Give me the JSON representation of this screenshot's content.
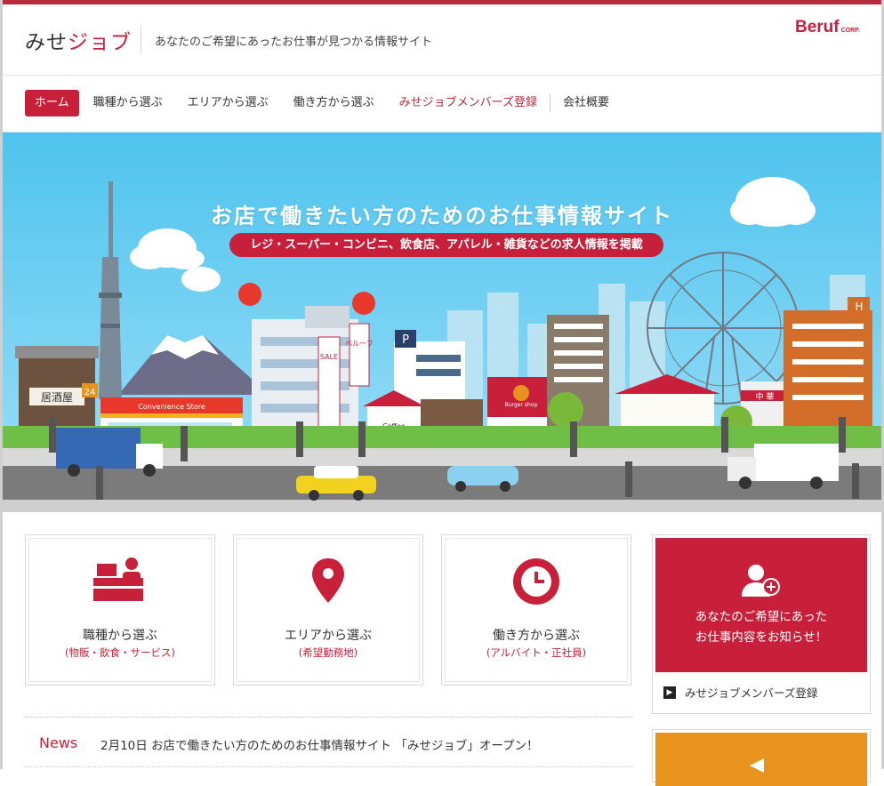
{
  "header": {
    "logo_part1": "みせ",
    "logo_part2": "ジョブ",
    "tagline": "あなたのご希望にあったお仕事が見つかる情報サイト",
    "brand": "Beruf",
    "brand_suffix": "CORP."
  },
  "nav": {
    "items": [
      {
        "label": "ホーム"
      },
      {
        "label": "職種から選ぶ"
      },
      {
        "label": "エリアから選ぶ"
      },
      {
        "label": "働き方から選ぶ"
      },
      {
        "label": "みせジョブメンバーズ登録"
      },
      {
        "label": "会社概要"
      }
    ]
  },
  "hero": {
    "title": "お店で働きたい方のためのお仕事情報サイト",
    "subtitle": "レジ・スーパー・コンビニ、飲食店、アパレル・雑貨などの求人情報を掲載",
    "signs": {
      "izakaya": "居酒屋",
      "store_24": "24",
      "convenience": "Convenience Store",
      "coffee": "Coffee",
      "burger": "Burger shop",
      "parking": "P",
      "hotel": "H",
      "chinese": "中 華",
      "sale": "SALE",
      "beruf_banner": "ベルーフ"
    }
  },
  "cards": [
    {
      "title": "職種から選ぶ",
      "sub": "(物販・飲食・サービス)",
      "icon": "register-clerk-icon"
    },
    {
      "title": "エリアから選ぶ",
      "sub": "(希望勤務地)",
      "icon": "map-pin-icon"
    },
    {
      "title": "働き方から選ぶ",
      "sub": "(アルバイト・正社員)",
      "icon": "clock-icon"
    }
  ],
  "members": {
    "line1": "あなたのご希望にあった",
    "line2": "お仕事内容をお知らせ！",
    "link": "みせジョブメンバーズ登録",
    "arrow": "▶"
  },
  "news": {
    "label": "News",
    "item": "2月10日  お店で働きたい方のためのお仕事情報サイト 「みせジョブ」オープン！"
  },
  "colors": {
    "accent": "#c8203a",
    "sky": "#5bc9f0",
    "orange": "#e8931e"
  }
}
